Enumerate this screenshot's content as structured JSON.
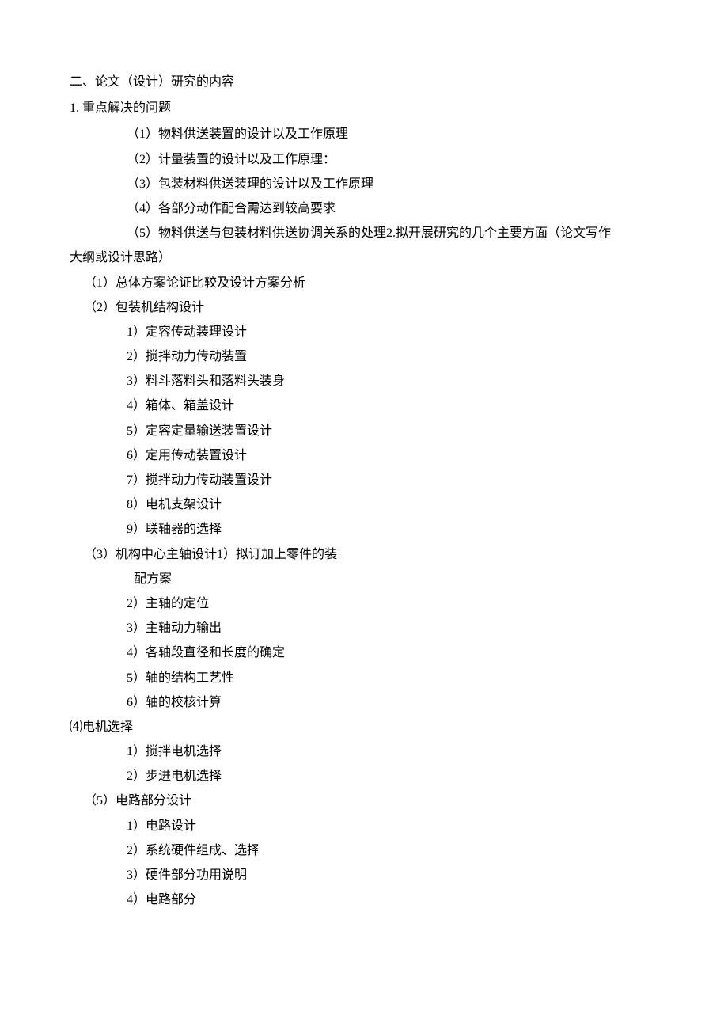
{
  "section": {
    "title": "二、论文（设计）研究的内容",
    "sub1": {
      "title": "1. 重点解决的问题",
      "items": [
        "（1）物料供送装置的设计以及工作原理",
        "（2）计量装置的设计以及工作原理：",
        "（3）包装材料供送装理的设计以及工作原理",
        "（4）各部分动作配合需达到较高要求",
        "（5）物料供送与包装材料供送协调关系的处理2.拟开展研究的几个主要方面（论文写作"
      ],
      "continuation": "大纲或设计思路）"
    },
    "outline": {
      "item1": "（1）总体方案论证比较及设计方案分析",
      "item2": {
        "title": "（2）包装机结构设计",
        "subs": [
          "1）定容传动装理设计",
          "2）搅拌动力传动装置",
          "3）料斗落料头和落料头装身",
          "4）箱体、箱盖设计",
          "5）定容定量输送装置设计",
          "6）定用传动装置设计",
          "7）搅拌动力传动装置设计",
          "8）电机支架设计",
          "9）联轴器的选择"
        ]
      },
      "item3": {
        "title": "（3）机构中心主轴设计1）拟订加上零件的装",
        "cont": "配方案",
        "subs": [
          "2）主轴的定位",
          "3）主轴动力输出",
          "4）各轴段直径和长度的确定",
          "5）轴的结构工艺性",
          "6）轴的校核计算"
        ]
      },
      "item4": {
        "title": "⑷电机选择",
        "subs": [
          "1）搅拌电机选择",
          "2）步进电机选择"
        ]
      },
      "item5": {
        "title": "（5）电路部分设计",
        "subs": [
          "1）电路设计",
          "2）系统硬件组成、选择",
          "3）硬件部分功用说明",
          "4）电路部分"
        ]
      }
    }
  }
}
